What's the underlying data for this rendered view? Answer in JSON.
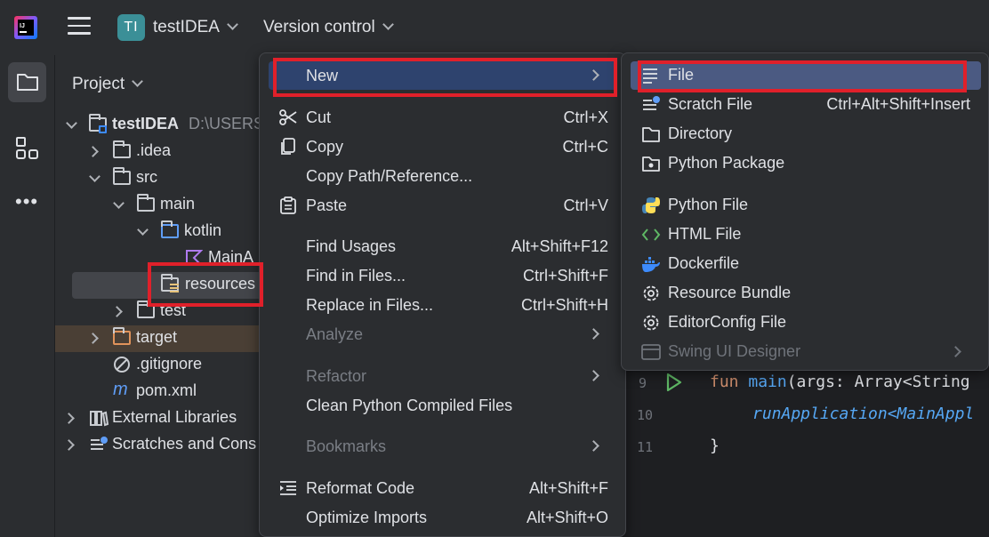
{
  "topbar": {
    "project_badge": "TI",
    "project_name": "testIDEA",
    "vcs_label": "Version control"
  },
  "project_panel": {
    "title": "Project",
    "tree": [
      {
        "label": "testIDEA",
        "extra": "D:\\USERS",
        "icon": "module-folder-icon"
      },
      {
        "label": ".idea",
        "icon": "folder-icon"
      },
      {
        "label": "src",
        "icon": "folder-icon"
      },
      {
        "label": "main",
        "icon": "folder-icon"
      },
      {
        "label": "kotlin",
        "icon": "source-folder-icon"
      },
      {
        "label": "MainA",
        "icon": "kotlin-file-icon"
      },
      {
        "label": "resources",
        "icon": "resources-folder-icon"
      },
      {
        "label": "test",
        "icon": "folder-icon"
      },
      {
        "label": "target",
        "icon": "excluded-folder-icon"
      },
      {
        "label": ".gitignore",
        "icon": "ignore-file-icon"
      },
      {
        "label": "pom.xml",
        "icon": "maven-icon"
      },
      {
        "label": "External Libraries",
        "icon": "library-icon"
      },
      {
        "label": "Scratches and Cons",
        "icon": "scratches-icon"
      }
    ]
  },
  "context_menu": {
    "items": [
      {
        "label": "New",
        "shortcut": "",
        "submenu": true
      },
      {
        "label": "Cut",
        "shortcut": "Ctrl+X"
      },
      {
        "label": "Copy",
        "shortcut": "Ctrl+C"
      },
      {
        "label": "Copy Path/Reference...",
        "shortcut": ""
      },
      {
        "label": "Paste",
        "shortcut": "Ctrl+V"
      },
      {
        "label": "Find Usages",
        "shortcut": "Alt+Shift+F12"
      },
      {
        "label": "Find in Files...",
        "shortcut": "Ctrl+Shift+F"
      },
      {
        "label": "Replace in Files...",
        "shortcut": "Ctrl+Shift+H"
      },
      {
        "label": "Analyze",
        "shortcut": "",
        "submenu": true
      },
      {
        "label": "Refactor",
        "shortcut": "",
        "submenu": true
      },
      {
        "label": "Clean Python Compiled Files",
        "shortcut": ""
      },
      {
        "label": "Bookmarks",
        "shortcut": "",
        "submenu": true
      },
      {
        "label": "Reformat Code",
        "shortcut": "Alt+Shift+F"
      },
      {
        "label": "Optimize Imports",
        "shortcut": "Alt+Shift+O"
      }
    ]
  },
  "new_submenu": {
    "items": [
      {
        "label": "File",
        "shortcut": "",
        "icon": "text-file-icon"
      },
      {
        "label": "Scratch File",
        "shortcut": "Ctrl+Alt+Shift+Insert",
        "icon": "scratch-file-icon"
      },
      {
        "label": "Directory",
        "shortcut": "",
        "icon": "folder-icon"
      },
      {
        "label": "Python Package",
        "shortcut": "",
        "icon": "python-package-icon"
      },
      {
        "label": "Python File",
        "shortcut": "",
        "icon": "python-icon"
      },
      {
        "label": "HTML File",
        "shortcut": "",
        "icon": "html-icon"
      },
      {
        "label": "Dockerfile",
        "shortcut": "",
        "icon": "docker-icon"
      },
      {
        "label": "Resource Bundle",
        "shortcut": "",
        "icon": "gear-icon"
      },
      {
        "label": "EditorConfig File",
        "shortcut": "",
        "icon": "gear-icon"
      },
      {
        "label": "Swing UI Designer",
        "shortcut": "",
        "icon": "form-icon",
        "submenu": true
      }
    ]
  },
  "editor": {
    "lines": [
      {
        "number": "9",
        "code_kw": "fun",
        "code_fn": "main",
        "code_rest": "(args: ",
        "code_type": "Array<String"
      },
      {
        "number": "10",
        "code": "runApplication<MainAppl"
      },
      {
        "number": "11",
        "code": "}"
      }
    ]
  },
  "colors": {
    "background": "#2b2d30",
    "editor_background": "#1e1f22",
    "highlight_red": "#e0202a",
    "selection": "#43454a",
    "submenu_active": "#4b5a82",
    "keyword": "#cf8e6d",
    "function": "#56a8f5",
    "type": "#e8c47b"
  }
}
